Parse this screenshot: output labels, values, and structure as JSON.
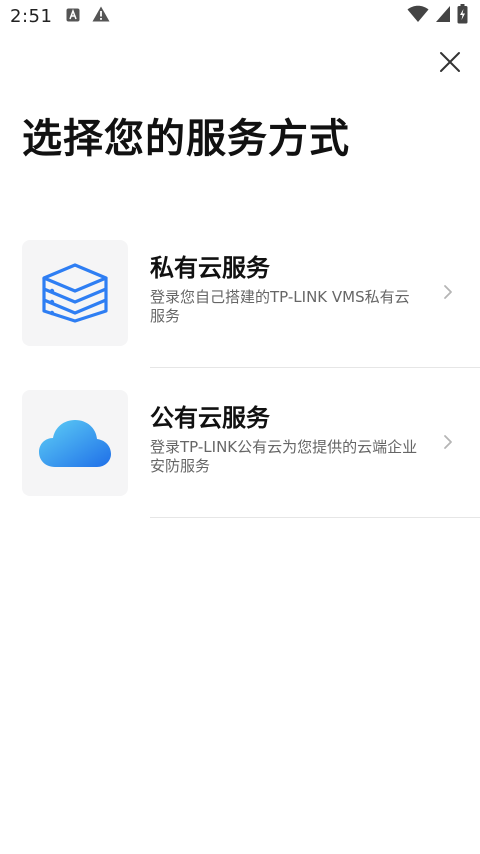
{
  "status_bar": {
    "time": "2:51"
  },
  "icons": {
    "close": "close-icon",
    "private_cloud": "server-stack-icon",
    "public_cloud": "cloud-icon",
    "chevron": "chevron-right-icon"
  },
  "title": "选择您的服务方式",
  "options": [
    {
      "title": "私有云服务",
      "description": "登录您自己搭建的TP-LINK VMS私有云服务"
    },
    {
      "title": "公有云服务",
      "description": "登录TP-LINK公有云为您提供的云端企业安防服务"
    }
  ],
  "colors": {
    "accent_blue": "#2e7ef3",
    "cloud_light": "#5fd0f6",
    "cloud_dark": "#1f6fe8",
    "tile_bg": "#f5f5f6",
    "secondary_text": "#666666"
  }
}
